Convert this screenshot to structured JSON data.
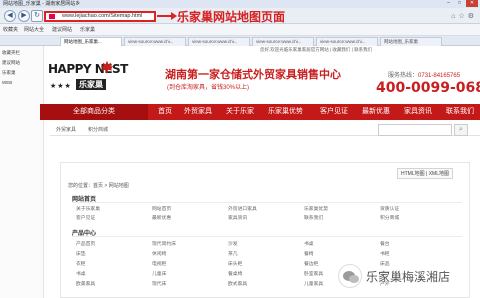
{
  "browser": {
    "window_title": "网站地图_乐家巢 - 湖南家居网站乡",
    "address": "www.lejiachao.com/Sitemap.html",
    "annotation": "乐家巢网站地图页面",
    "favorites": [
      "收藏夹",
      "网站大全",
      "建议网站",
      "乐家巢",
      "WEB"
    ],
    "tabs": [
      "网站地图_乐家巢...",
      "view-source:www.chi...",
      "view-source:www.chi...",
      "view-source:www.chi...",
      "view-source:www.chi...",
      "网站地图_乐家巢"
    ]
  },
  "sidebar": {
    "items": [
      "收藏夹栏",
      "建议网站",
      "乐家巢",
      "WEB"
    ]
  },
  "site": {
    "top_info": "您好,欢迎光临乐家巢家居官方网站 | 收藏我们 | 联系我们",
    "logo_en": "HAPPY NEST",
    "logo_cn": "乐家巢",
    "logo_stars": "★★★",
    "slogan": "湖南第一家仓储式外贸家具销售中心",
    "subslogan": "(到仓库淘家具，省钱30%以上)",
    "hotline_label": "服务热线：",
    "hotline_phone": "0731-84165765",
    "phone": "400-0099-068"
  },
  "nav": {
    "all_categories": "全部商品分类",
    "items": [
      "首页",
      "外贸家具",
      "关于乐家",
      "乐家巢优势",
      "客户见证",
      "最新优惠",
      "家具资讯",
      "联系我们"
    ]
  },
  "breadcrumb": {
    "items": [
      "外贸家具",
      "积分商城"
    ]
  },
  "content": {
    "map_links": "HTML地图 | XML地图",
    "location": "您的位置：首页 > 网站地图",
    "sections": [
      {
        "title": "网站首页",
        "rows": [
          [
            "关于乐家巢",
            "网站首页",
            "外贸进口家具",
            "乐家巢优势",
            "资质认证"
          ],
          [
            "客户见证",
            "最新优惠",
            "家具资讯",
            "联系我们",
            "积分商城"
          ]
        ]
      },
      {
        "title": "产品中心",
        "rows": [
          [
            "产品首页",
            "现代简约床",
            "沙发",
            "书桌",
            "餐台"
          ],
          [
            "床垫",
            "休闲椅",
            "茶几",
            "餐椅",
            "书柜"
          ],
          [
            "衣柜",
            "电视柜",
            "床头柜",
            "餐边柜",
            "床品"
          ],
          [
            "书桌",
            "儿童床",
            "餐桌椅",
            "卧室家具",
            "客厅"
          ],
          [
            "欧美家具",
            "现代床",
            "欧式家具",
            "儿童家具",
            "户外"
          ]
        ]
      }
    ]
  },
  "watermark": "乐家巢梅溪湘店",
  "colors": {
    "brand_red": "#c41919",
    "annotation_red": "#d62020"
  }
}
